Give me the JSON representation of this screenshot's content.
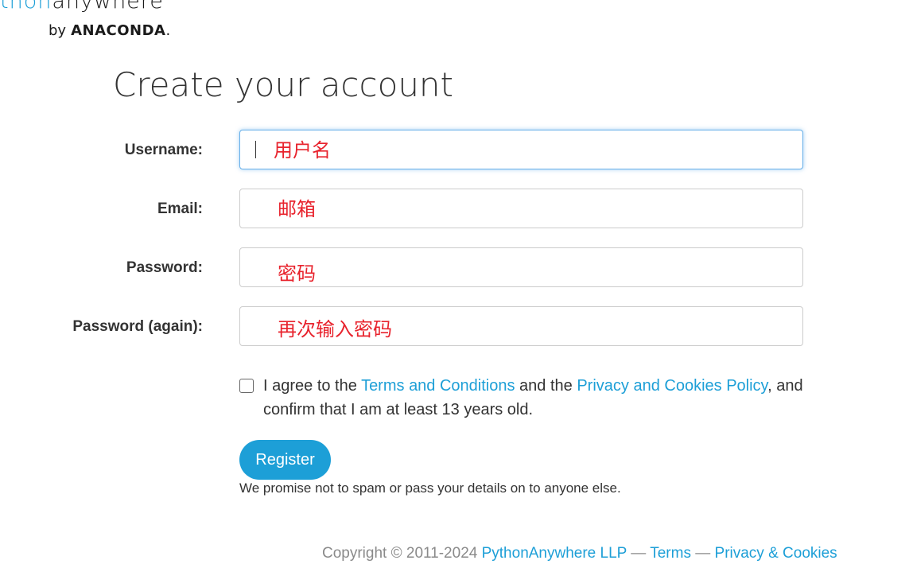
{
  "logo": {
    "wordmark_prefix": "thon",
    "wordmark_suffix": "anywhere",
    "by": "by",
    "brand": "ANACONDA",
    "brand_dot": "."
  },
  "page_title": "Create your account",
  "form": {
    "fields": [
      {
        "label": "Username:",
        "hint": "用户名",
        "focused": true
      },
      {
        "label": "Email:",
        "hint": "邮箱",
        "focused": false
      },
      {
        "label": "Password:",
        "hint": "密码",
        "focused": false
      },
      {
        "label": "Password (again):",
        "hint": "再次输入密码",
        "focused": false
      }
    ],
    "agree": {
      "checked": false,
      "text_before": "I agree to the ",
      "terms_link": "Terms and Conditions",
      "text_middle": " and the ",
      "privacy_link": "Privacy and Cookies Policy",
      "text_after": ", and confirm that I am at least 13 years old."
    },
    "register_label": "Register",
    "promise": "We promise not to spam or pass your details on to anyone else."
  },
  "footer": {
    "copyright": "Copyright © 2011-2024 ",
    "company_link": "PythonAnywhere LLP",
    "sep1": " — ",
    "terms_link": "Terms",
    "sep2": " — ",
    "privacy_link": "Privacy & Cookies"
  },
  "colors": {
    "accent": "#1d9fd7",
    "hint_red": "#e8232d",
    "focus_border": "#66afe9"
  }
}
